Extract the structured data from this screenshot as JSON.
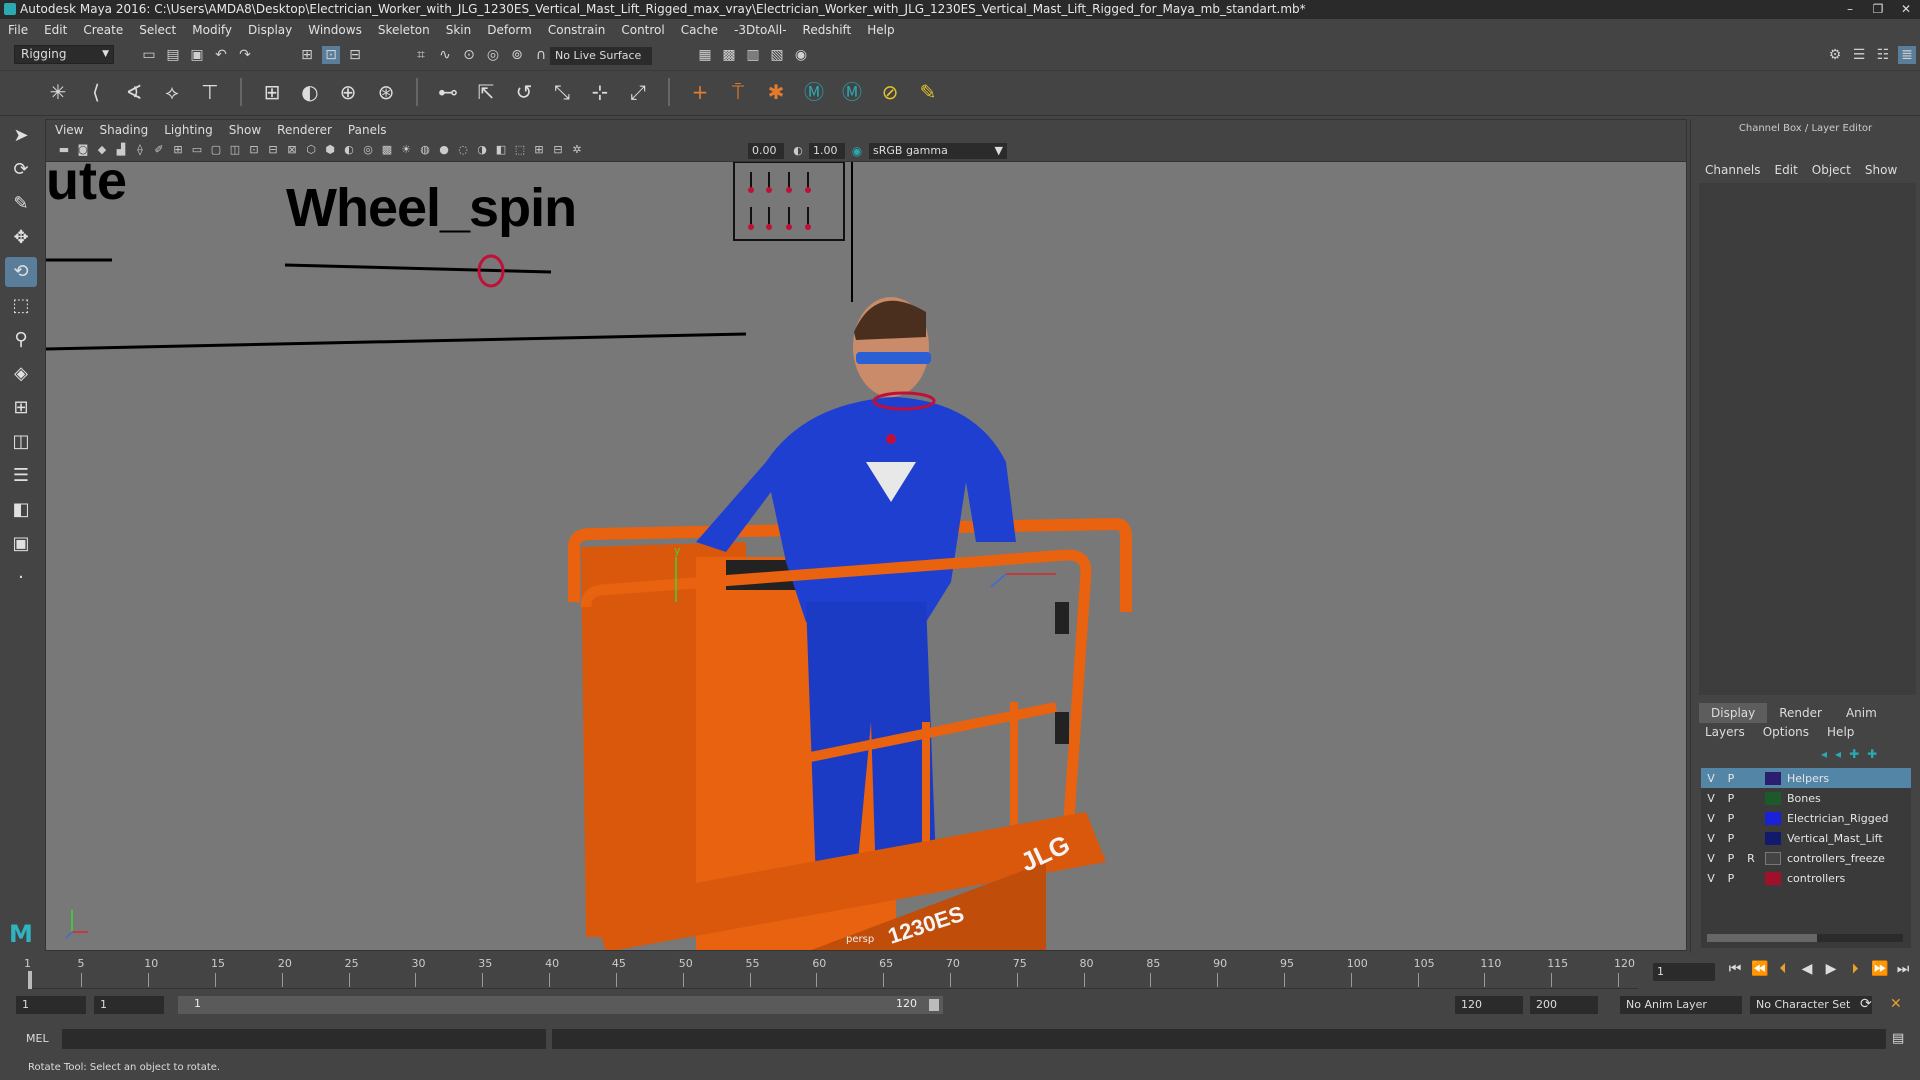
{
  "window": {
    "title": "Autodesk Maya 2016: C:\\Users\\AMDA8\\Desktop\\Electrician_Worker_with_JLG_1230ES_Vertical_Mast_Lift_Rigged_max_vray\\Electrician_Worker_with_JLG_1230ES_Vertical_Mast_Lift_Rigged_for_Maya_mb_standart.mb*",
    "controls": [
      "–",
      "❐",
      "✕"
    ]
  },
  "menubar": [
    "File",
    "Edit",
    "Create",
    "Select",
    "Modify",
    "Display",
    "Windows",
    "Skeleton",
    "Skin",
    "Deform",
    "Constrain",
    "Control",
    "Cache",
    "-3DtoAll-",
    "Redshift",
    "Help"
  ],
  "statusline": {
    "mode": "Rigging",
    "live_surface": "No Live Surface"
  },
  "viewport": {
    "menu": [
      "View",
      "Shading",
      "Lighting",
      "Show",
      "Renderer",
      "Panels"
    ],
    "near_value": "0.00",
    "far_value": "1.00",
    "color_space": "sRGB gamma",
    "scene_text_1": "Wheel_spin",
    "scene_text_2": "ute",
    "camera_label": "persp",
    "platform_text": "JLG",
    "model_text": "1230ES"
  },
  "channelbox": {
    "title": "Channel Box / Layer Editor",
    "menu": [
      "Channels",
      "Edit",
      "Object",
      "Show"
    ],
    "layer_tabs": [
      "Display",
      "Render",
      "Anim"
    ],
    "active_tab": "Display",
    "layer_menu": [
      "Layers",
      "Options",
      "Help"
    ],
    "layers": [
      {
        "v": "V",
        "p": "P",
        "r": "",
        "name": "Helpers",
        "color": "#2a1f6e",
        "selected": true
      },
      {
        "v": "V",
        "p": "P",
        "r": "",
        "name": "Bones",
        "color": "#1c5a2b",
        "selected": false
      },
      {
        "v": "V",
        "p": "P",
        "r": "",
        "name": "Electrician_Rigged",
        "color": "#1a22d8",
        "selected": false
      },
      {
        "v": "V",
        "p": "P",
        "r": "",
        "name": "Vertical_Mast_Lift",
        "color": "#121a6e",
        "selected": false
      },
      {
        "v": "V",
        "p": "P",
        "r": "R",
        "name": "controllers_freeze",
        "color": "#444444",
        "selected": false
      },
      {
        "v": "V",
        "p": "P",
        "r": "",
        "name": "controllers",
        "color": "#a0102a",
        "selected": false
      }
    ]
  },
  "timeline": {
    "ticks": [
      "1",
      "5",
      "10",
      "15",
      "20",
      "25",
      "30",
      "35",
      "40",
      "45",
      "50",
      "55",
      "60",
      "65",
      "70",
      "75",
      "80",
      "85",
      "90",
      "95",
      "100",
      "105",
      "110",
      "115",
      "120"
    ],
    "current_frame": "1"
  },
  "range": {
    "start": "1",
    "playback_start": "1",
    "slider_start": "1",
    "slider_end": "120",
    "playback_end": "120",
    "end": "200",
    "anim_layer": "No Anim Layer",
    "character_set": "No Character Set"
  },
  "command": {
    "label": "MEL"
  },
  "help_line": "Rotate Tool: Select an object to rotate.",
  "colors": {
    "accent": "#5285a6",
    "lift_orange": "#e8620f",
    "uniform_blue": "#1f3fd0"
  }
}
